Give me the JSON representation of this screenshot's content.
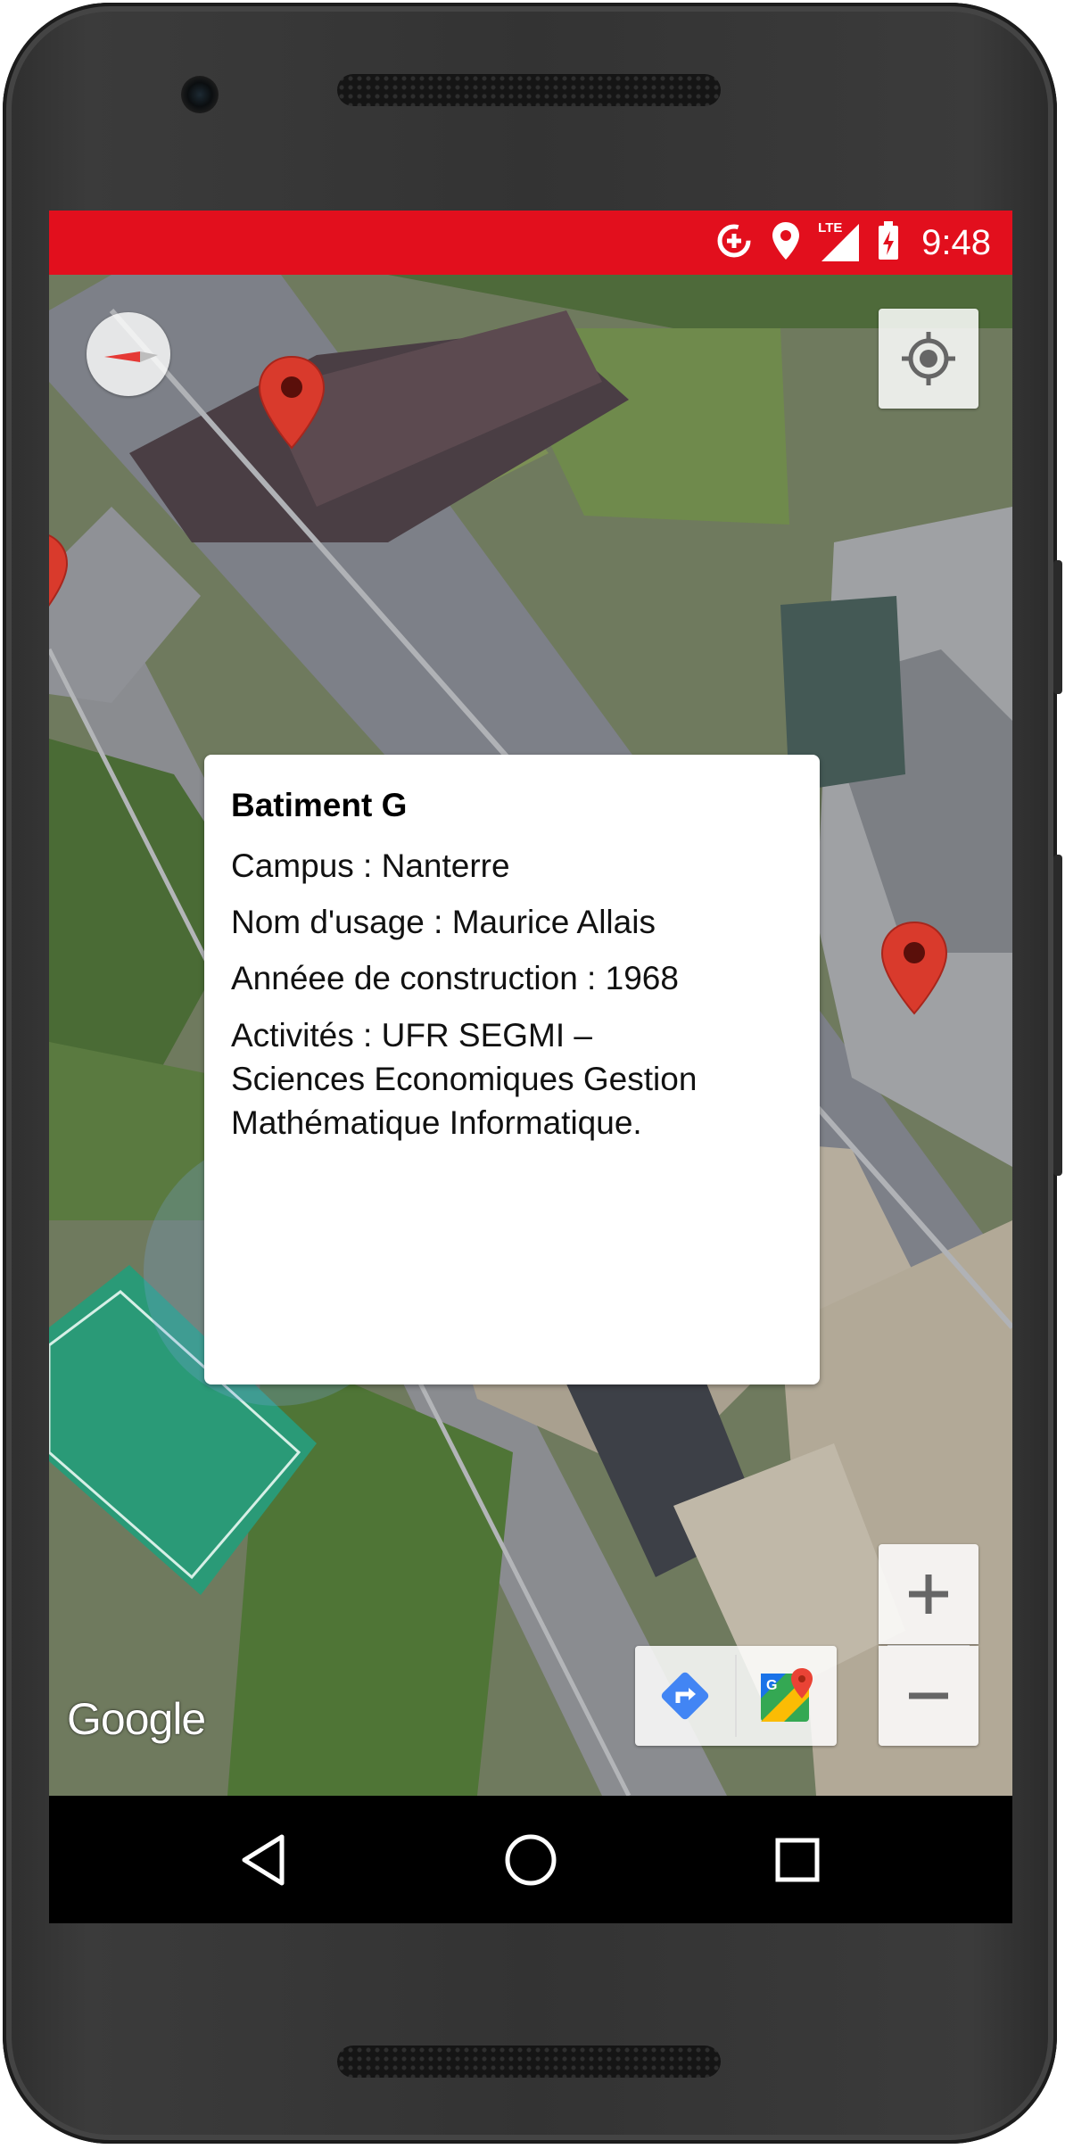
{
  "status_bar": {
    "time": "9:48",
    "network": "LTE",
    "color": "#e20f1d",
    "icons": [
      "data-saver-icon",
      "location-icon",
      "lte-signal-icon",
      "battery-charging-icon"
    ]
  },
  "map": {
    "type": "satellite",
    "attribution": "Google",
    "controls": {
      "compass": "compass-icon",
      "my_location": "my-location-icon",
      "zoom_in": "+",
      "zoom_out": "−",
      "directions": "directions-icon",
      "open_maps": "google-maps-icon"
    },
    "markers": [
      "marker-top",
      "marker-left-edge",
      "marker-right",
      "marker-selected"
    ],
    "user_location_dot": true
  },
  "info_window": {
    "title": "Batiment G",
    "campus": "Campus : Nanterre",
    "nom_usage": "Nom d'usage : Maurice Allais",
    "annee": "Annéee de construction : 1968",
    "activites_1": "Activités : UFR SEGMI –",
    "activites_2": "Sciences Economiques Gestion",
    "activites_3": "Mathématique Informatique."
  },
  "nav_bar": {
    "back": "back-icon",
    "home": "home-icon",
    "recents": "recents-icon"
  }
}
